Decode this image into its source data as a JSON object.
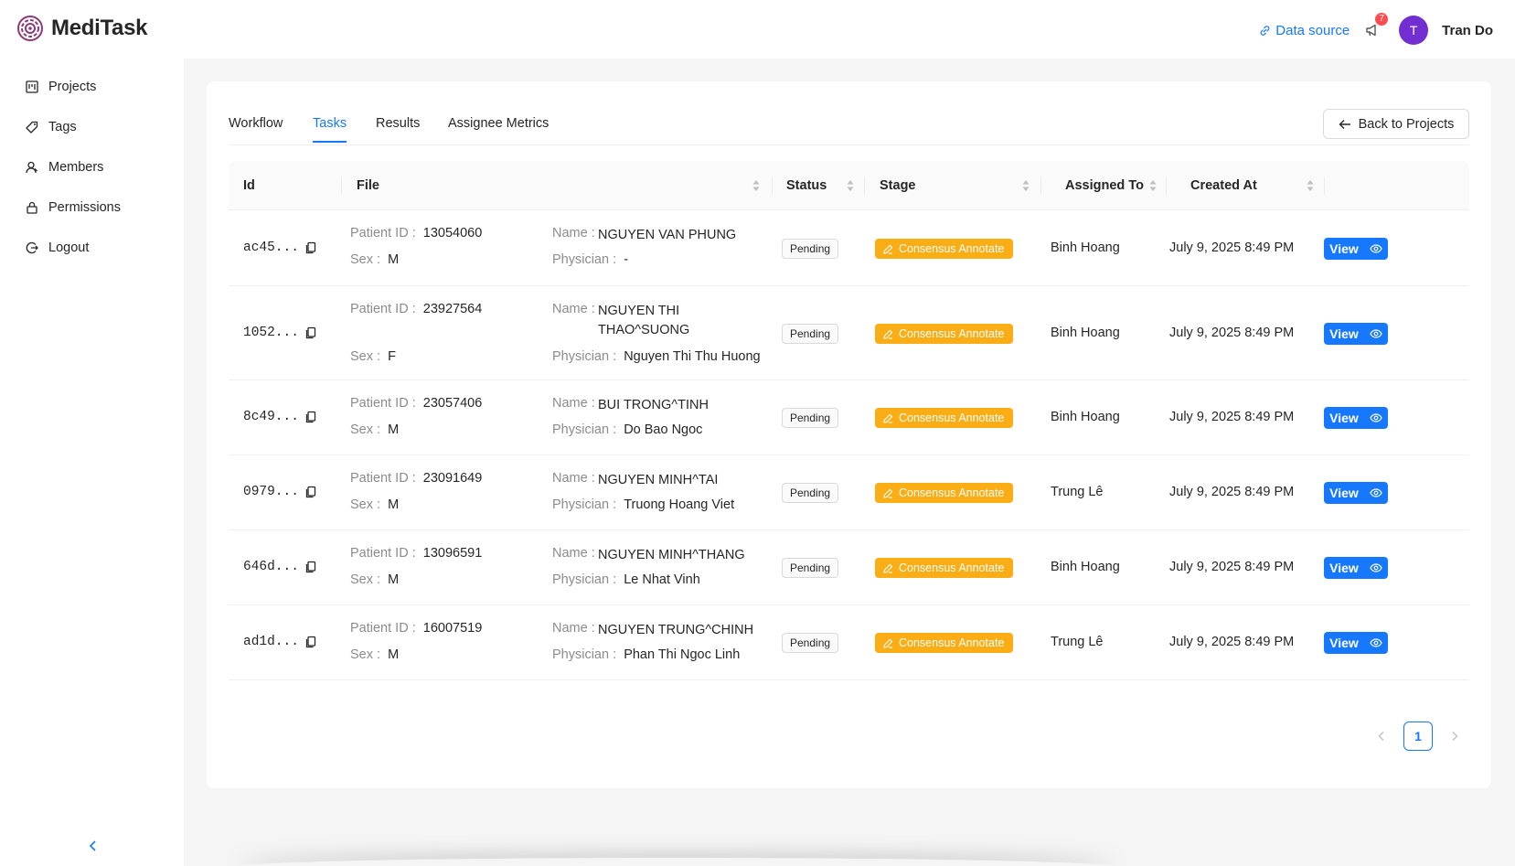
{
  "app": {
    "name": "MediTask"
  },
  "header": {
    "data_source": "Data source",
    "notification_count": "7",
    "avatar_initial": "T",
    "user_name": "Tran Do"
  },
  "sidebar": {
    "items": [
      {
        "label": "Projects",
        "icon": "projects-icon"
      },
      {
        "label": "Tags",
        "icon": "tag-icon"
      },
      {
        "label": "Members",
        "icon": "members-icon"
      },
      {
        "label": "Permissions",
        "icon": "lock-icon"
      },
      {
        "label": "Logout",
        "icon": "logout-icon"
      }
    ]
  },
  "tabs": [
    {
      "label": "Workflow"
    },
    {
      "label": "Tasks",
      "active": true
    },
    {
      "label": "Results"
    },
    {
      "label": "Assignee Metrics"
    }
  ],
  "back_button": "Back to Projects",
  "table": {
    "columns": [
      "Id",
      "File",
      "Status",
      "Stage",
      "Assigned To",
      "Created At"
    ],
    "labels": {
      "patient_id": "Patient ID",
      "sex": "Sex",
      "name": "Name",
      "physician": "Physician"
    },
    "view_label": "View",
    "rows": [
      {
        "id": "ac45...",
        "patient_id": "13054060",
        "sex": "M",
        "name": "NGUYEN VAN PHUNG",
        "physician": "-",
        "status": "Pending",
        "stage": "Consensus Annotate",
        "assigned_to": "Binh Hoang",
        "created_at": "July 9, 2025 8:49 PM"
      },
      {
        "id": "1052...",
        "patient_id": "23927564",
        "sex": "F",
        "name": "NGUYEN THI THAO^SUONG",
        "physician": "Nguyen Thi Thu Huong",
        "status": "Pending",
        "stage": "Consensus Annotate",
        "assigned_to": "Binh Hoang",
        "created_at": "July 9, 2025 8:49 PM"
      },
      {
        "id": "8c49...",
        "patient_id": "23057406",
        "sex": "M",
        "name": "BUI TRONG^TINH",
        "physician": "Do Bao Ngoc",
        "status": "Pending",
        "stage": "Consensus Annotate",
        "assigned_to": "Binh Hoang",
        "created_at": "July 9, 2025 8:49 PM"
      },
      {
        "id": "0979...",
        "patient_id": "23091649",
        "sex": "M",
        "name": "NGUYEN MINH^TAI",
        "physician": "Truong Hoang Viet",
        "status": "Pending",
        "stage": "Consensus Annotate",
        "assigned_to": "Trung Lê",
        "created_at": "July 9, 2025 8:49 PM"
      },
      {
        "id": "646d...",
        "patient_id": "13096591",
        "sex": "M",
        "name": "NGUYEN MINH^THANG",
        "physician": "Le Nhat Vinh",
        "status": "Pending",
        "stage": "Consensus Annotate",
        "assigned_to": "Binh Hoang",
        "created_at": "July 9, 2025 8:49 PM"
      },
      {
        "id": "ad1d...",
        "patient_id": "16007519",
        "sex": "M",
        "name": "NGUYEN TRUNG^CHINH",
        "physician": "Phan Thi Ngoc Linh",
        "status": "Pending",
        "stage": "Consensus Annotate",
        "assigned_to": "Trung Lê",
        "created_at": "July 9, 2025 8:49 PM"
      }
    ]
  },
  "pagination": {
    "current_page": "1"
  },
  "colors": {
    "primary": "#1677ff",
    "stage": "#faad14",
    "avatar": "#722ed1",
    "badge": "#ff4d4f"
  }
}
